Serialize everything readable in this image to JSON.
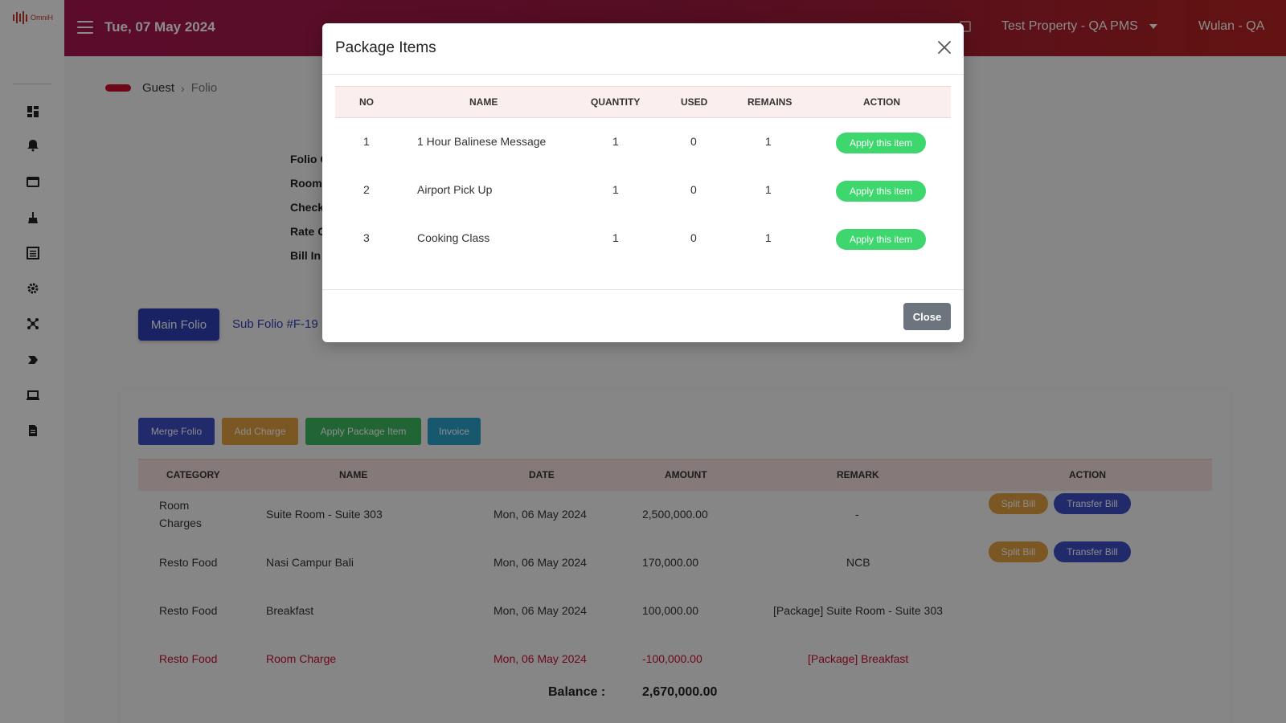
{
  "brand": {
    "logo_text": "OmniH"
  },
  "header": {
    "date": "Tue, 07 May 2024",
    "property": "Test Property - QA PMS",
    "user": "Wulan - QA"
  },
  "breadcrumb": {
    "parent": "Guest",
    "current": "Folio"
  },
  "folio_info": {
    "labels": [
      "Folio C",
      "Room",
      "Check",
      "Rate C",
      "Bill In"
    ]
  },
  "folio_tabs": {
    "main": "Main Folio",
    "sub": "Sub Folio #F-19"
  },
  "actions": {
    "merge": "Merge Folio",
    "add_charge": "Add Charge",
    "apply_package": "Apply Package Item",
    "invoice": "Invoice"
  },
  "folio_table": {
    "headers": [
      "CATEGORY",
      "NAME",
      "DATE",
      "AMOUNT",
      "REMARK",
      "ACTION"
    ],
    "rows": [
      {
        "category_line1": "Room",
        "category_line2": "Charges",
        "name": "Suite Room - Suite 303",
        "date": "Mon, 06 May 2024",
        "amount": "2,500,000.00",
        "remark": "-",
        "split": "Split Bill",
        "transfer": "Transfer Bill"
      },
      {
        "category_line1": "Resto Food",
        "category_line2": "",
        "name": "Nasi Campur Bali",
        "date": "Mon, 06 May 2024",
        "amount": "170,000.00",
        "remark": "NCB",
        "split": "Split Bill",
        "transfer": "Transfer Bill"
      },
      {
        "category_line1": "Resto Food",
        "category_line2": "",
        "name": "Breakfast",
        "date": "Mon, 06 May 2024",
        "amount": "100,000.00",
        "remark": "[Package] Suite Room - Suite 303"
      },
      {
        "category_line1": "Resto Food",
        "category_line2": "",
        "name": "Room Charge",
        "date": "Mon, 06 May 2024",
        "amount": "-100,000.00",
        "remark": "[Package] Breakfast"
      }
    ],
    "balance_label": "Balance :",
    "balance_value": "2,670,000.00"
  },
  "modal": {
    "title": "Package Items",
    "headers": [
      "NO",
      "NAME",
      "QUANTITY",
      "USED",
      "REMAINS",
      "ACTION"
    ],
    "rows": [
      {
        "no": "1",
        "name": "1 Hour Balinese Message",
        "quantity": "1",
        "used": "0",
        "remains": "1",
        "action": "Apply this item"
      },
      {
        "no": "2",
        "name": "Airport Pick Up",
        "quantity": "1",
        "used": "0",
        "remains": "1",
        "action": "Apply this item"
      },
      {
        "no": "3",
        "name": "Cooking Class",
        "quantity": "1",
        "used": "0",
        "remains": "1",
        "action": "Apply this item"
      }
    ],
    "close_label": "Close"
  },
  "colors": {
    "primary": "#2f3fb3",
    "warning": "#e0a040",
    "success": "#3dd76e",
    "info": "#2aa0c8",
    "danger": "#c8102e",
    "secondary": "#6c757d"
  }
}
